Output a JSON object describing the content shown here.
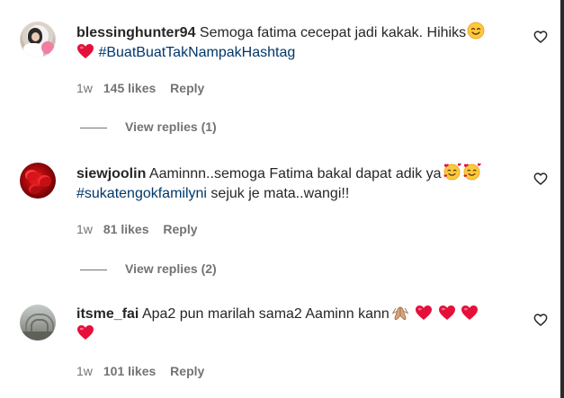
{
  "comments": [
    {
      "username": "blessinghunter94",
      "text_before_tag": " Semoga fatima cecepat jadi kakak. Hihiks",
      "hashtag": "#BuatBuatTakNampakHashtag",
      "text_after_tag": "",
      "emojis": [
        "smiling-face-icon",
        "red-heart-icon"
      ],
      "time": "1w",
      "likes": "145 likes",
      "reply_label": "Reply",
      "view_replies": "View replies (1)"
    },
    {
      "username": "siewjoolin",
      "text_before_tag": " Aaminnn..semoga Fatima bakal dapat adik ya",
      "hashtag": "#sukatengokfamilyni",
      "text_after_tag": " sejuk je mata..wangi!!",
      "emojis": [
        "smiling-face-with-hearts-icon",
        "smiling-face-with-hearts-icon"
      ],
      "time": "1w",
      "likes": "81 likes",
      "reply_label": "Reply",
      "view_replies": "View replies (2)"
    },
    {
      "username": "itsme_fai",
      "text_before_tag": " Apa2 pun marilah sama2 Aaminn kann",
      "hashtag": "",
      "text_after_tag": "",
      "emojis": [
        "folded-hands-icon",
        "red-heart-icon",
        "red-heart-icon",
        "red-heart-icon",
        "red-heart-icon"
      ],
      "time": "1w",
      "likes": "101 likes",
      "reply_label": "Reply"
    }
  ],
  "colors": {
    "text": "#262626",
    "secondary": "#737373",
    "hashtag": "#00376b",
    "heart": "#e5103a"
  }
}
